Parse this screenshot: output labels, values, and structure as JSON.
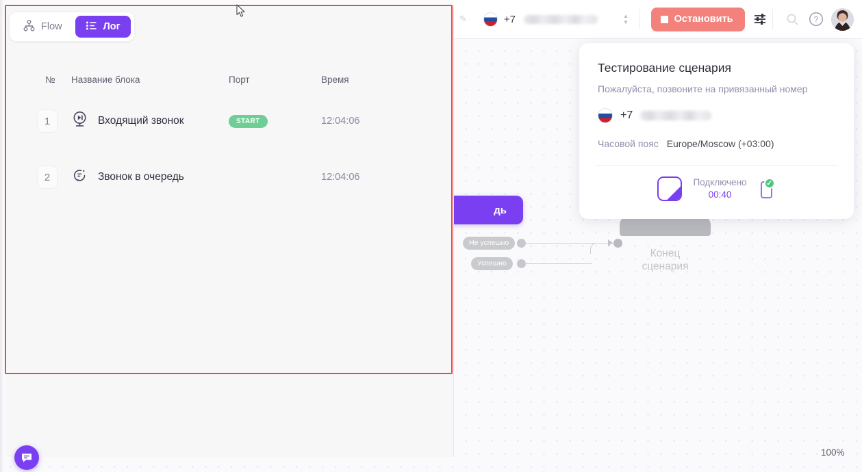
{
  "toolbar": {
    "phone_prefix": "+7",
    "phone_masked": "",
    "stop_button": "Остановить",
    "icons": {
      "pencil": "pencil-icon",
      "flag": "russia-flag-icon",
      "stepper": "stepper-icon",
      "filters": "sliders-icon",
      "search": "search-icon",
      "help": "help-circle-icon",
      "avatar": "user-avatar"
    }
  },
  "card": {
    "title": "Тестирование сценария",
    "subtitle": "Пожалуйста, позвоните на привязанный номер",
    "phone_prefix": "+7",
    "timezone_label": "Часовой пояс",
    "timezone_value": "Europe/Moscow (+03:00)",
    "status_label": "Подключено",
    "status_time": "00:40"
  },
  "panel": {
    "tabs": [
      {
        "label": "Flow",
        "icon": "sitemap-icon",
        "active": false
      },
      {
        "label": "Лог",
        "icon": "list-icon",
        "active": true
      }
    ],
    "columns": [
      "№",
      "Название блока",
      "Порт",
      "Время"
    ],
    "rows": [
      {
        "num": "1",
        "name": "Входящий звонок",
        "icon": "incoming-call-icon",
        "port": "START",
        "time": "12:04:06"
      },
      {
        "num": "2",
        "name": "Звонок в очередь",
        "icon": "queue-call-icon",
        "port": "",
        "time": "12:04:06"
      }
    ]
  },
  "canvas": {
    "queue_node_label": "дь",
    "port_fail": "Не успешно",
    "port_ok": "Успешно",
    "end_node_label": "Конец\nсценария",
    "end_node_line1": "Конец",
    "end_node_line2": "сценария",
    "zoom_level": "100%"
  },
  "colors": {
    "accent_purple": "#7b3ff2",
    "stop_red": "#f4827c",
    "badge_green": "#6fce95",
    "annotation_red": "#f5433d",
    "muted_text": "#8f90ad"
  }
}
